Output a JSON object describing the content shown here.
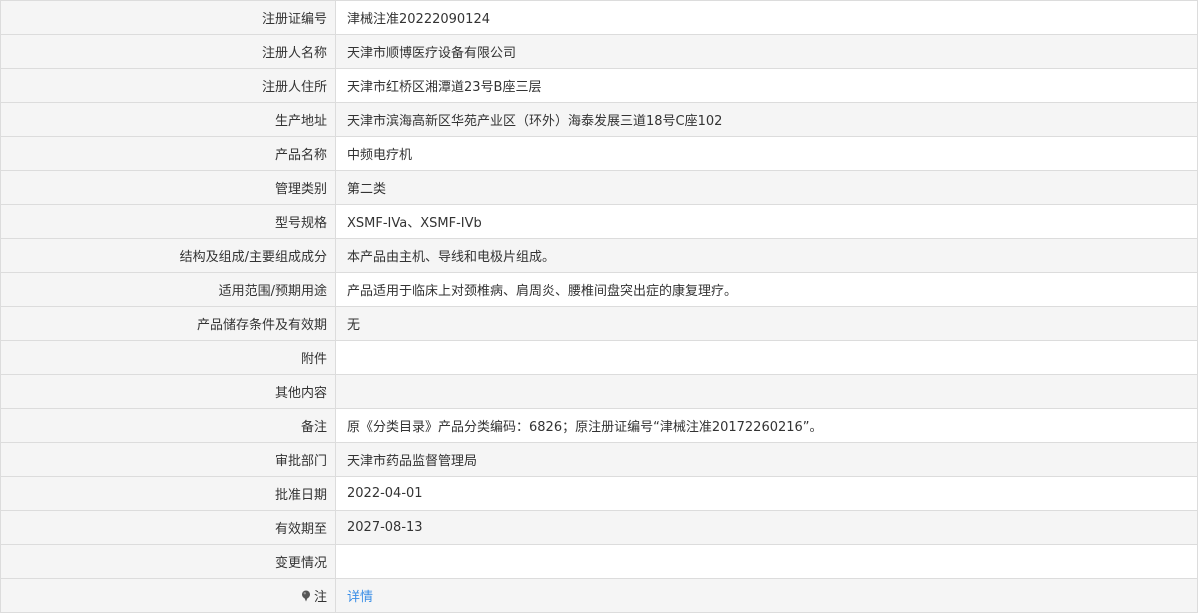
{
  "rows": [
    {
      "label": "注册证编号",
      "value": "津械注准20222090124"
    },
    {
      "label": "注册人名称",
      "value": "天津市顺博医疗设备有限公司"
    },
    {
      "label": "注册人住所",
      "value": "天津市红桥区湘潭道23号B座三层"
    },
    {
      "label": "生产地址",
      "value": "天津市滨海高新区华苑产业区（环外）海泰发展三道18号C座102"
    },
    {
      "label": "产品名称",
      "value": "中频电疗机"
    },
    {
      "label": "管理类别",
      "value": "第二类"
    },
    {
      "label": "型号规格",
      "value": "XSMF-IVa、XSMF-IVb"
    },
    {
      "label": "结构及组成/主要组成成分",
      "value": "本产品由主机、导线和电极片组成。"
    },
    {
      "label": "适用范围/预期用途",
      "value": "产品适用于临床上对颈椎病、肩周炎、腰椎间盘突出症的康复理疗。"
    },
    {
      "label": "产品储存条件及有效期",
      "value": "无"
    },
    {
      "label": "附件",
      "value": ""
    },
    {
      "label": "其他内容",
      "value": ""
    },
    {
      "label": "备注",
      "value": "原《分类目录》产品分类编码：6826；原注册证编号“津械注准20172260216”。"
    },
    {
      "label": "审批部门",
      "value": "天津市药品监督管理局"
    },
    {
      "label": "批准日期",
      "value": "2022-04-01"
    },
    {
      "label": "有效期至",
      "value": "2027-08-13"
    },
    {
      "label": "变更情况",
      "value": ""
    }
  ],
  "note": {
    "icon": "pin-icon",
    "label": "注",
    "link_text": "详情"
  },
  "colors": {
    "label_bg": "#f5f5f5",
    "border": "#dcdcdc",
    "link": "#3a8ee6",
    "text": "#333333"
  }
}
